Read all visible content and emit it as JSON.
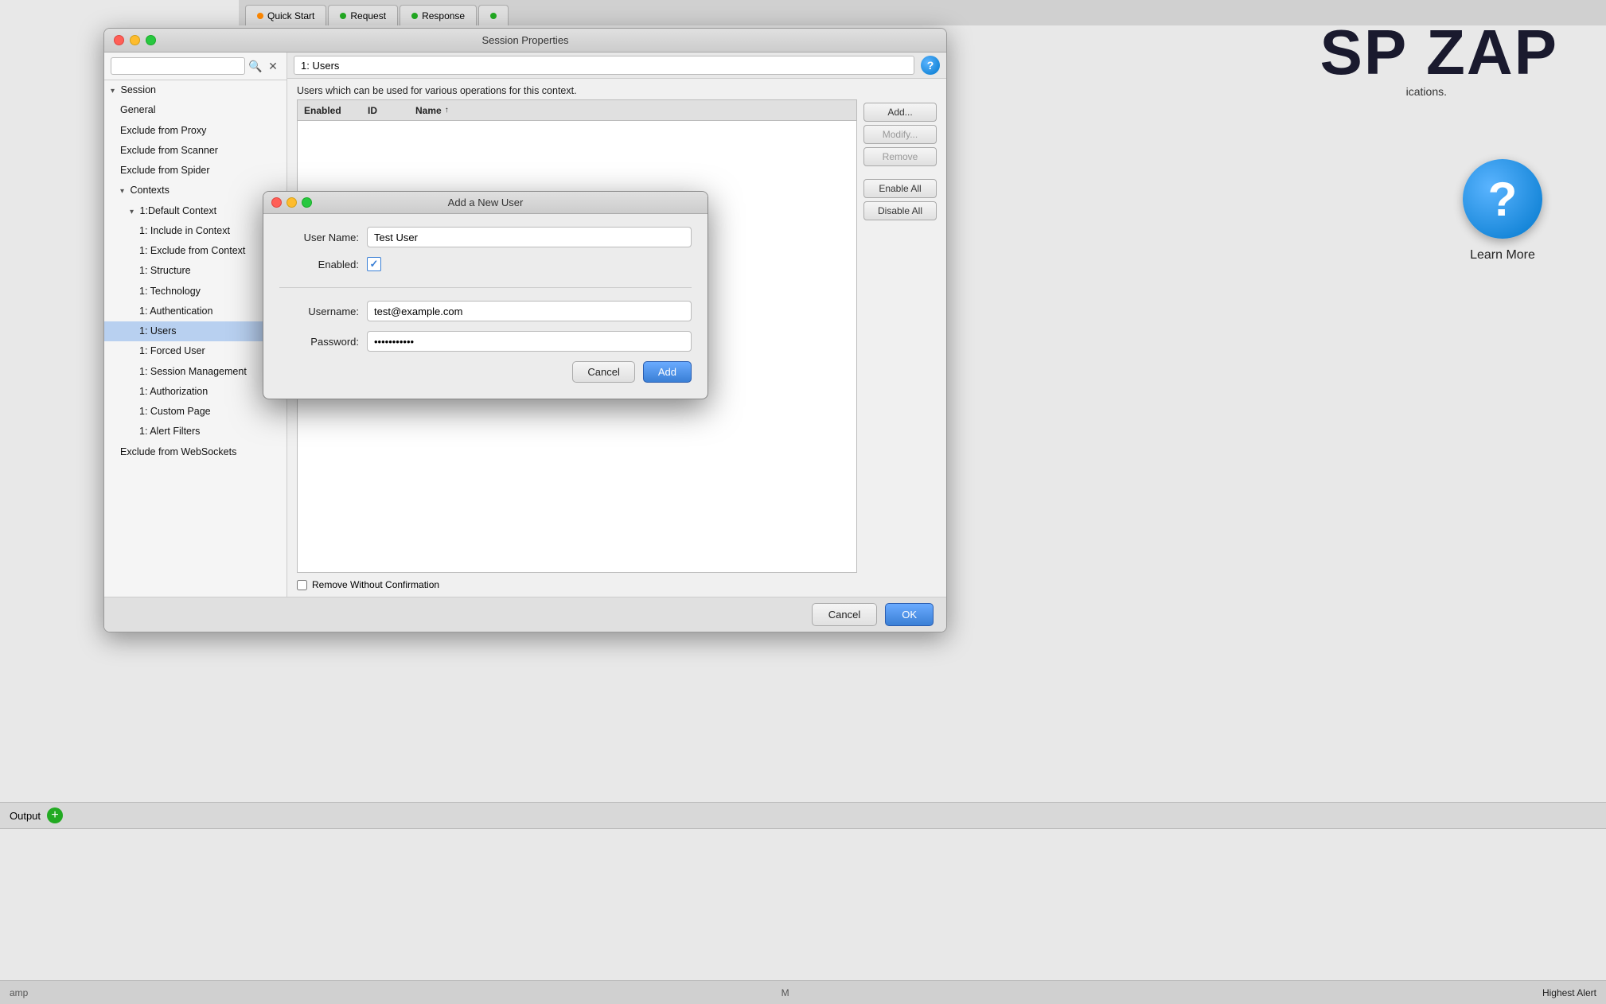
{
  "app": {
    "title": "SP ZAP",
    "subtitle": "ications."
  },
  "tabs": [
    {
      "label": "Quick Start",
      "dot_color": "#ff8800"
    },
    {
      "label": "Request",
      "dot_color": "#22aa22"
    },
    {
      "label": "Response",
      "dot_color": "#22aa22"
    },
    {
      "label": "",
      "dot_color": "#22aa22"
    }
  ],
  "window": {
    "title": "Session Properties"
  },
  "context_title": "1: Users",
  "context_description": "Users which can be used for various operations for this context.",
  "table": {
    "columns": [
      "Enabled",
      "ID",
      "Name",
      ""
    ],
    "rows": []
  },
  "buttons": {
    "add": "Add...",
    "modify": "Modify...",
    "remove": "Remove",
    "enable_all": "Enable All",
    "disable_all": "Disable All"
  },
  "bottom_checkbox": {
    "label": "Remove Without Confirmation"
  },
  "footer": {
    "cancel": "Cancel",
    "ok": "OK"
  },
  "sidebar": {
    "search_placeholder": "",
    "items": [
      {
        "label": "Session",
        "level": 0,
        "expanded": true
      },
      {
        "label": "General",
        "level": 1
      },
      {
        "label": "Exclude from Proxy",
        "level": 1
      },
      {
        "label": "Exclude from Scanner",
        "level": 1
      },
      {
        "label": "Exclude from Spider",
        "level": 1
      },
      {
        "label": "Contexts",
        "level": 1,
        "expanded": true
      },
      {
        "label": "1:Default Context",
        "level": 2,
        "expanded": true
      },
      {
        "label": "1: Include in Context",
        "level": 3
      },
      {
        "label": "1: Exclude from Context",
        "level": 3
      },
      {
        "label": "1: Structure",
        "level": 3
      },
      {
        "label": "1: Technology",
        "level": 3
      },
      {
        "label": "1: Authentication",
        "level": 3
      },
      {
        "label": "1: Users",
        "level": 3,
        "selected": true
      },
      {
        "label": "1: Forced User",
        "level": 3
      },
      {
        "label": "1: Session Management",
        "level": 3
      },
      {
        "label": "1: Authorization",
        "level": 3
      },
      {
        "label": "1: Custom Page",
        "level": 3
      },
      {
        "label": "1: Alert Filters",
        "level": 3
      },
      {
        "label": "Exclude from WebSockets",
        "level": 1
      }
    ]
  },
  "dialog": {
    "title": "Add a New User",
    "fields": {
      "user_name_label": "User Name:",
      "user_name_value": "Test User",
      "enabled_label": "Enabled:",
      "enabled_checked": true,
      "username_label": "Username:",
      "username_value": "test@example.com",
      "password_label": "Password:",
      "password_value": "••••••••••••"
    },
    "cancel": "Cancel",
    "add": "Add"
  },
  "learn_more": {
    "label": "Learn More"
  },
  "output": {
    "label": "Output",
    "add_icon": "+"
  },
  "status_bar": {
    "left": "amp",
    "middle": "M",
    "right": "Highest Alert"
  }
}
